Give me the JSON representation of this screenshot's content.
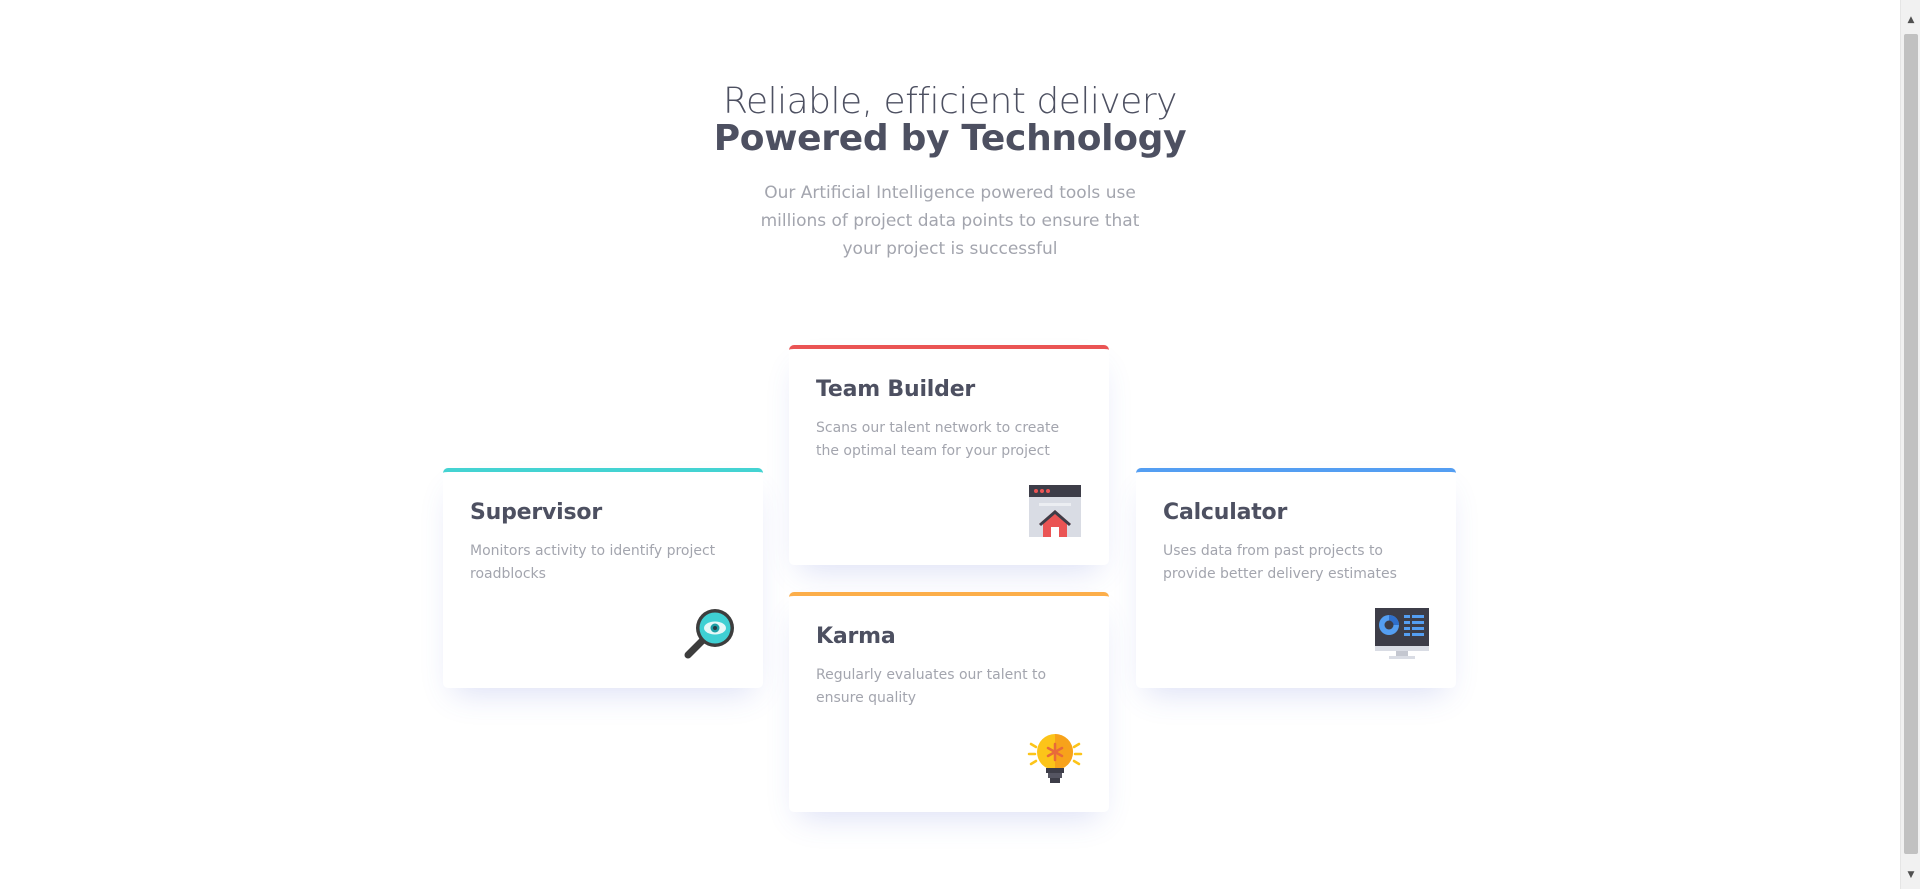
{
  "header": {
    "title_light": "Reliable, efficient delivery",
    "title_bold": "Powered by Technology",
    "intro": "Our Artificial Intelligence powered tools use millions of project data points to ensure that your project is successful"
  },
  "cards": [
    {
      "title": "Supervisor",
      "text": "Monitors activity to identify project roadblocks",
      "accent": "#44d3d2",
      "icon": "magnifier-eye-icon"
    },
    {
      "title": "Team Builder",
      "text": "Scans our talent network to create the optimal team for your project",
      "accent": "#ea5454",
      "icon": "team-builder-icon"
    },
    {
      "title": "Karma",
      "text": "Regularly evaluates our talent to ensure quality",
      "accent": "#fcae4a",
      "icon": "lightbulb-icon"
    },
    {
      "title": "Calculator",
      "text": "Uses data from past projects to provide better delivery estimates",
      "accent": "#549ef2",
      "icon": "monitor-chart-icon"
    }
  ],
  "colors": {
    "heading": "#4d5061",
    "body_text": "#a3a5ae",
    "background": "#ffffff"
  }
}
